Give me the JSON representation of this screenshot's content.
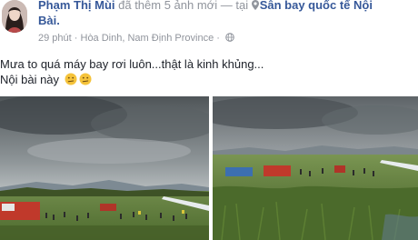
{
  "post": {
    "author": "Phạm Thị Mùi",
    "action": "đã thêm 5 ảnh mới",
    "separator": "— tại",
    "location_line1": "Sân bay quốc tế Nội",
    "location_line2": "Bài.",
    "time": "29 phút",
    "dot": "·",
    "place": "Hòa Dinh, Nam Định Province",
    "text_line1": "Mưa to quá máy bay rơi luôn...thật là kinh khủng...",
    "text_line2": "Nội bài này"
  },
  "icons": {
    "avatar": "avatar-photo",
    "location": "map-pin-icon",
    "audience": "globe-icon",
    "emoji": "confused-face-emoji"
  },
  "colors": {
    "link": "#365899",
    "meta": "#90949c",
    "text": "#1d2129"
  }
}
